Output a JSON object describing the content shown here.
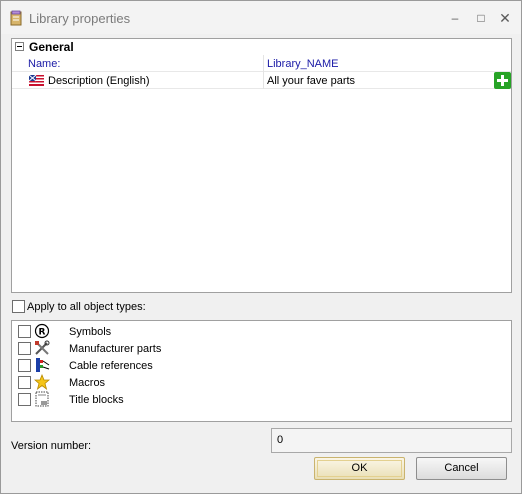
{
  "window": {
    "title": "Library properties",
    "controls": {
      "minimize": "–",
      "maximize": "□",
      "close": "✕"
    }
  },
  "properties": {
    "category": "General",
    "rows": [
      {
        "name": "Name:",
        "value": "Library_NAME",
        "name_color": "#1a1aa6"
      },
      {
        "name": "Description (English)",
        "value": "All your fave parts",
        "flag": "us-uk-flag-icon"
      }
    ]
  },
  "apply_all": {
    "label": "Apply to all object types:",
    "checked": false
  },
  "object_types": [
    {
      "label": "Symbols",
      "icon": "symbol-icon",
      "checked": false
    },
    {
      "label": "Manufacturer parts",
      "icon": "manufacturer-parts-icon",
      "checked": false
    },
    {
      "label": "Cable references",
      "icon": "cable-references-icon",
      "checked": false
    },
    {
      "label": "Macros",
      "icon": "macro-star-icon",
      "checked": false
    },
    {
      "label": "Title blocks",
      "icon": "title-block-icon",
      "checked": false
    }
  ],
  "version": {
    "label": "Version number:",
    "value": "0"
  },
  "buttons": {
    "ok": "OK",
    "cancel": "Cancel"
  },
  "colors": {
    "accent_blue": "#1a1aa6",
    "add_green": "#27a326"
  }
}
